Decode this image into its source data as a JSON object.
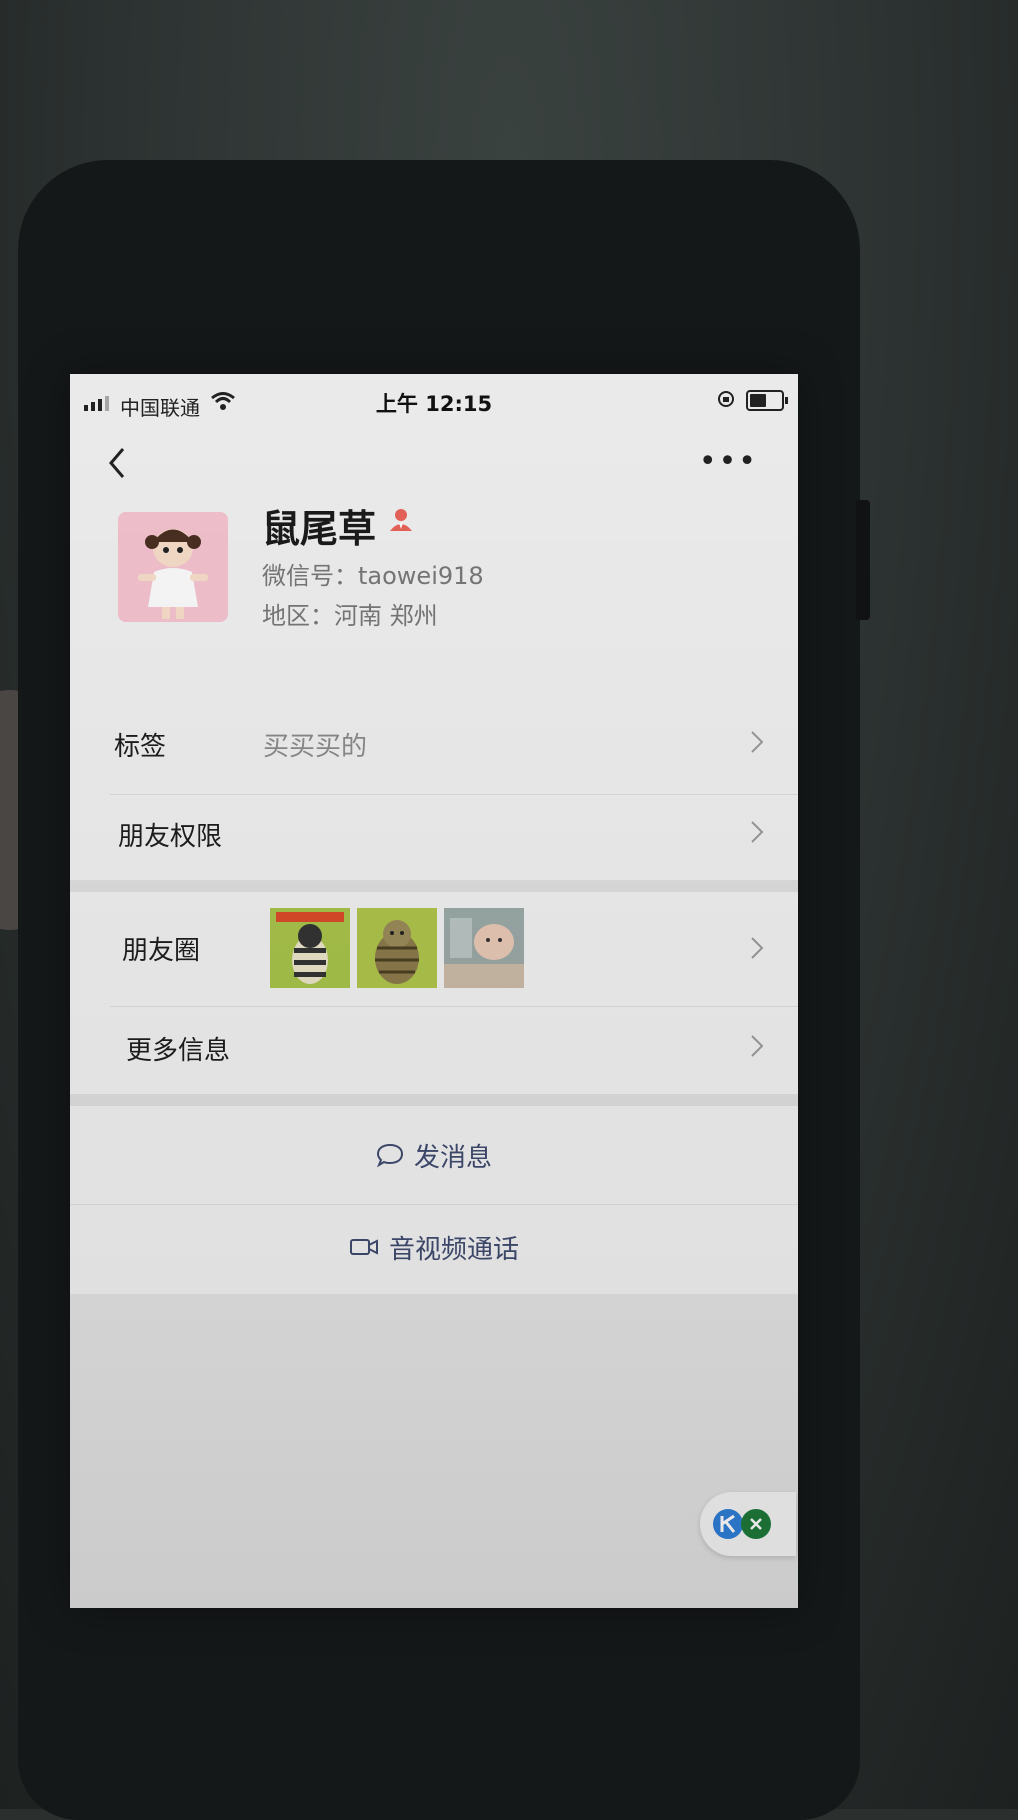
{
  "status_bar": {
    "carrier": "中国联通",
    "time": "上午 12:15",
    "battery_level": 0.6
  },
  "nav": {
    "more_label": "•••"
  },
  "profile": {
    "nickname": "鼠尾草",
    "wechat_id": "微信号：taowei918",
    "region": "地区：河南 郑州"
  },
  "rows": {
    "tags_label": "标签",
    "tags_value": "买买买的",
    "permissions_label": "朋友权限",
    "moments_label": "朋友圈",
    "more_info_label": "更多信息"
  },
  "moments_thumbs": [
    "cat-striped-thumb",
    "cat-tabby-thumb",
    "baby-photo-thumb"
  ],
  "actions": {
    "send_message": "发消息",
    "av_call": "音视频通话"
  },
  "colors": {
    "accent_link": "#3f4a6e",
    "user_icon": "#e8625a",
    "float_blue": "#2f7fd8",
    "float_green": "#1e7a3a"
  }
}
